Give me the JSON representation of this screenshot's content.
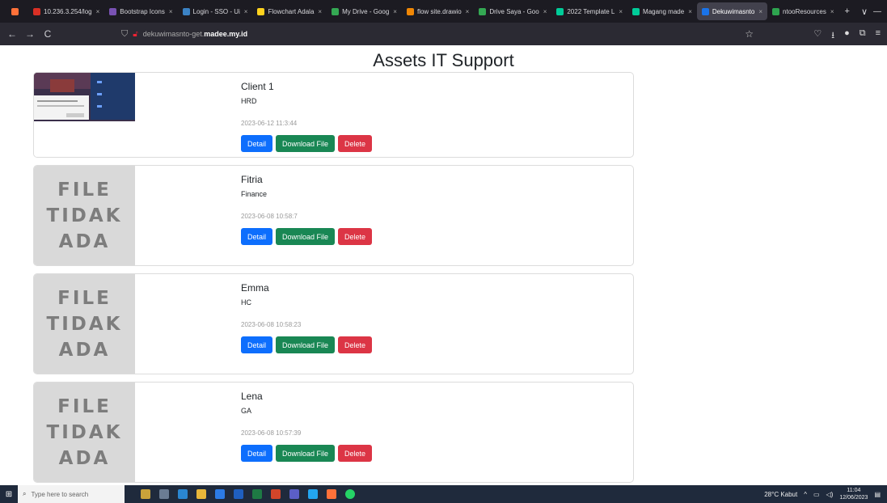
{
  "browser": {
    "tabs": [
      {
        "label": "",
        "color": "#ff7139",
        "active": false,
        "firefox": true
      },
      {
        "label": "10.236.3.254/log",
        "color": "#d93025",
        "active": false
      },
      {
        "label": "Bootstrap Icons",
        "color": "#7952b3",
        "active": false
      },
      {
        "label": "Login - SSO - Ui",
        "color": "#3b82c4",
        "active": false
      },
      {
        "label": "Flowchart Adala",
        "color": "#ffd21e",
        "active": false
      },
      {
        "label": "My Drive - Goog",
        "color": "#34a853",
        "active": false
      },
      {
        "label": "flow site.drawio",
        "color": "#f08705",
        "active": false
      },
      {
        "label": "Drive Saya - Goo",
        "color": "#34a853",
        "active": false
      },
      {
        "label": "2022 Template L",
        "color": "#0c9",
        "active": false
      },
      {
        "label": "Magang made",
        "color": "#0c9",
        "active": false
      },
      {
        "label": "Dekuwimasnto",
        "color": "#1a73e8",
        "active": true
      },
      {
        "label": "ntooResources",
        "color": "#2ea44f",
        "active": false
      }
    ],
    "new_tab": "+",
    "tab_list": "∨",
    "window_controls": {
      "minimize": "—",
      "maximize": "❐",
      "close": "✕"
    },
    "url_prefix": "dekuwimasnto-get.",
    "url_host": "madee.my.id",
    "nav": {
      "back": "←",
      "forward": "→",
      "reload": "C"
    }
  },
  "page": {
    "title": "Assets IT Support",
    "missing_file_text": [
      "FILE",
      "TIDAK",
      "ADA"
    ],
    "buttons": {
      "detail": "Detail",
      "download": "Download File",
      "delete": "Delete"
    },
    "cards": [
      {
        "name": "Client 1",
        "department": "HRD",
        "date": "2023-06-12 11:3:44",
        "has_file": true
      },
      {
        "name": "Fitria",
        "department": "Finance",
        "date": "2023-06-08 10:58:7",
        "has_file": false
      },
      {
        "name": "Emma",
        "department": "HC",
        "date": "2023-06-08 10:58:23",
        "has_file": false
      },
      {
        "name": "Lena",
        "department": "GA",
        "date": "2023-06-08 10:57:39",
        "has_file": false
      }
    ]
  },
  "taskbar": {
    "search_placeholder": "Type here to search",
    "weather": "28°C Kabut",
    "time": "11:04",
    "date": "12/06/2023"
  }
}
